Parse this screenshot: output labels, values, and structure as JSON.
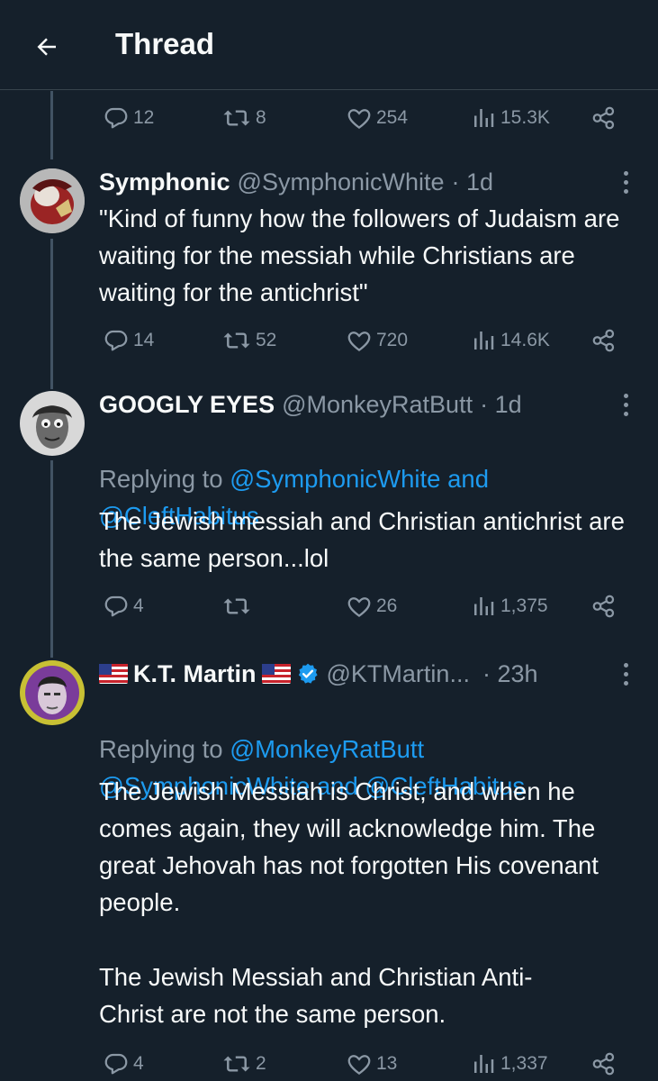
{
  "header": {
    "title": "Thread"
  },
  "prev_actions": {
    "replies": "12",
    "retweets": "8",
    "likes": "254",
    "views": "15.3K"
  },
  "tweets": [
    {
      "display_name": "Symphonic",
      "handle": "@SymphonicWhite",
      "time": "· 1d",
      "text": "\"Kind of funny how the followers of Judaism are waiting for the messiah while Christians are waiting for the antichrist\"",
      "actions": {
        "replies": "14",
        "retweets": "52",
        "likes": "720",
        "views": "14.6K"
      }
    },
    {
      "display_name": "GOOGLY EYES",
      "handle": "@MonkeyRatButt",
      "time": "· 1d",
      "replying_prefix": "Replying to ",
      "replying_mention_1": "@SymphonicWhite",
      "replying_and": " and",
      "replying_mention_2": "@CleftHabitus",
      "text": "The Jewish messiah and Christian antichrist are the same person...lol",
      "actions": {
        "replies": "4",
        "retweets": "",
        "likes": "26",
        "views": "1,375"
      }
    },
    {
      "display_name": "K.T. Martin",
      "handle": "@KTMartin...",
      "time": "· 23h",
      "replying_prefix": "Replying to ",
      "replying_mention_1": "@MonkeyRatButt",
      "replying_mention_2": "@SymphonicWhite",
      "replying_and": " and ",
      "replying_mention_3": "@CleftHabitus",
      "text_p1": "The Jewish Messiah is Christ, and when he comes again, they will acknowledge him. The great Jehovah has not forgotten His covenant people.",
      "text_p2": "The Jewish Messiah and Christian Anti-Christ are not the same person.",
      "actions": {
        "replies": "4",
        "retweets": "2",
        "likes": "13",
        "views": "1,337"
      }
    }
  ],
  "colors": {
    "background": "#15202b",
    "text": "#f7f9f9",
    "muted": "#8b98a5",
    "link": "#1d9bf0",
    "verified": "#1d9bf0",
    "divider": "#38444d"
  },
  "icons": [
    "back-arrow-icon",
    "reply-icon",
    "retweet-icon",
    "like-icon",
    "views-icon",
    "share-icon",
    "more-icon",
    "verified-badge-icon",
    "us-flag-icon"
  ]
}
